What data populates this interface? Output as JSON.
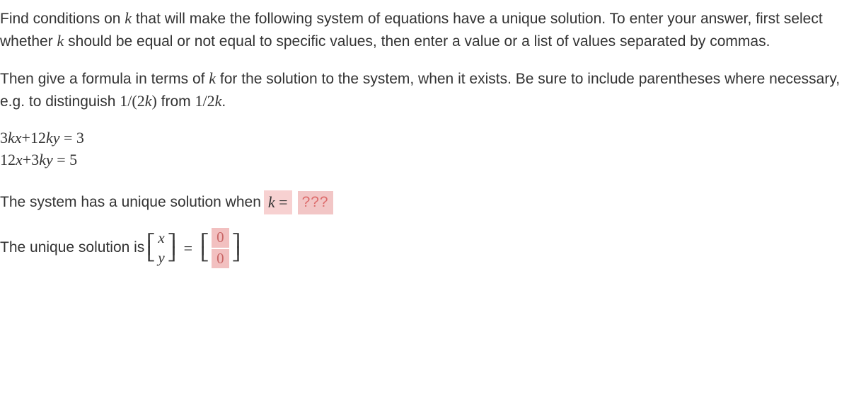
{
  "para1_part1": "Find conditions on ",
  "para1_k": "k",
  "para1_part2": " that will make the following system of equations have a unique solution. To enter your answer, first select whether ",
  "para1_k2": "k",
  "para1_part3": " should be equal or not equal to specific values, then enter a value or a list of values separated by commas.",
  "para2_part1": "Then give a formula in terms of ",
  "para2_k": "k",
  "para2_part2": " for the solution to the system, when it exists. Be sure to include parentheses where necessary, e.g. to distinguish ",
  "para2_frac1": "1/(2",
  "para2_frac1_k": "k",
  "para2_frac1_end": ")",
  "para2_from": " from ",
  "para2_frac2": "1/2",
  "para2_frac2_k": "k",
  "para2_end": ".",
  "eq1_coef1": "3",
  "eq1_kx": "kx",
  "eq1_plus": "+12",
  "eq1_ky": "ky",
  "eq1_rhs": " = 3",
  "eq2_coef1": "12",
  "eq2_x": "x",
  "eq2_plus": "+3",
  "eq2_ky": "ky",
  "eq2_rhs": " = 5",
  "ans1_text": "The system has a unique solution when ",
  "ans1_keq_k": "k",
  "ans1_keq_rest": " = ",
  "ans1_qmarks": "???",
  "ans2_text": "The unique solution is ",
  "vec_x": "x",
  "vec_y": "y",
  "eq_sign": "=",
  "sol_top": "0",
  "sol_bot": "0"
}
